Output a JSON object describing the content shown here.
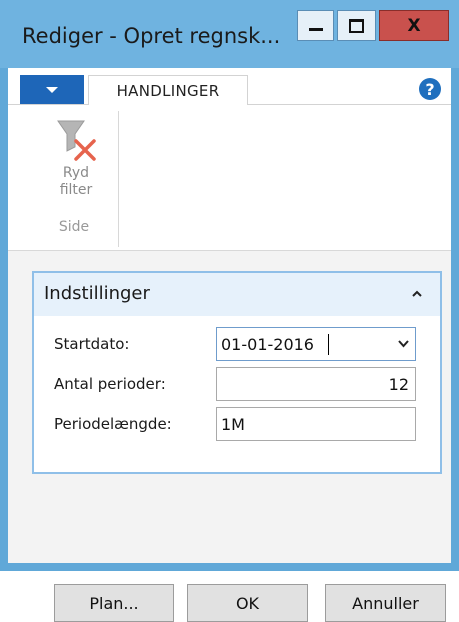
{
  "window": {
    "title": "Rediger - Opret regnsk...",
    "minimize_glyph": "—",
    "close_glyph": "X"
  },
  "ribbon": {
    "tabs": [
      {
        "label": "HANDLINGER"
      }
    ],
    "help_glyph": "?",
    "group": {
      "label": "Side",
      "buttons": [
        {
          "label_line1": "Ryd",
          "label_line2": "filter",
          "icon": "clear-filter-icon",
          "enabled": false
        }
      ]
    }
  },
  "fasttab": {
    "title": "Indstillinger",
    "fields": [
      {
        "label": "Startdato:",
        "value": "01-01-2016",
        "type": "dropdown-date",
        "focused": true
      },
      {
        "label": "Antal perioder:",
        "value": "12",
        "type": "number"
      },
      {
        "label": "Periodelængde:",
        "value": "1M",
        "type": "text"
      }
    ]
  },
  "actions": {
    "plan": "Plan...",
    "ok": "OK",
    "cancel": "Annuller"
  },
  "colors": {
    "titlebar": "#6fb3e0",
    "close_button": "#c9514d",
    "ribbon_accent": "#1e66b8",
    "fasttab_border": "#8fbfe8"
  }
}
